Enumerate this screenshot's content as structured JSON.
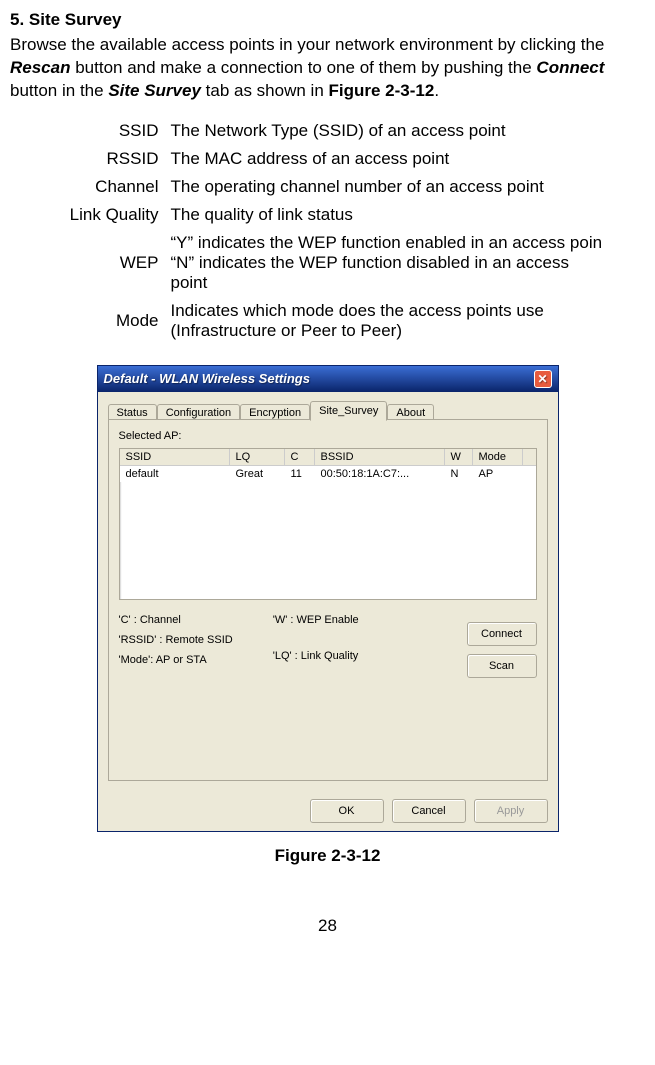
{
  "doc": {
    "heading": "5. Site Survey",
    "intro_pre": "Browse the available access points in your network environment by clicking the ",
    "intro_rescan": "Rescan",
    "intro_mid1": " button and make a connection to one of them by pushing the ",
    "intro_connect": "Connect",
    "intro_mid2": " button in the ",
    "intro_sitesurvey": "Site Survey",
    "intro_mid3": " tab as shown in ",
    "intro_figref": "Figure 2-3-12",
    "intro_end": ".",
    "defs": [
      {
        "term": "SSID",
        "desc": "The Network Type (SSID) of an access point"
      },
      {
        "term": "RSSID",
        "desc": "The MAC address of an access point"
      },
      {
        "term": "Channel",
        "desc": "The operating channel number of an access point"
      },
      {
        "term": "Link Quality",
        "desc": "The quality of link status"
      },
      {
        "term": "WEP",
        "desc": "“Y” indicates the WEP function enabled in an access poin\n“N” indicates the WEP function disabled in an access point"
      },
      {
        "term": "Mode",
        "desc": "Indicates which mode does the access points use (Infrastructure or Peer to Peer)"
      }
    ],
    "figure_caption": "Figure 2-3-12",
    "page_number": "28"
  },
  "window": {
    "title": "Default - WLAN Wireless Settings",
    "tabs": [
      "Status",
      "Configuration",
      "Encryption",
      "Site_Survey",
      "About"
    ],
    "active_tab_index": 3,
    "selected_ap_label": "Selected AP:",
    "columns": [
      "SSID",
      "LQ",
      "C",
      "BSSID",
      "W",
      "Mode"
    ],
    "rows": [
      {
        "ssid": "default",
        "lq": "Great",
        "c": "11",
        "bssid": "00:50:18:1A:C7:...",
        "w": "N",
        "mode": "AP"
      }
    ],
    "legend_left": [
      "'C' : Channel",
      "'RSSID' : Remote SSID",
      "'Mode': AP or STA"
    ],
    "legend_right": [
      "'W' : WEP Enable",
      "'LQ' : Link Quality"
    ],
    "btn_connect": "Connect",
    "btn_scan": "Scan",
    "btn_ok": "OK",
    "btn_cancel": "Cancel",
    "btn_apply": "Apply"
  }
}
